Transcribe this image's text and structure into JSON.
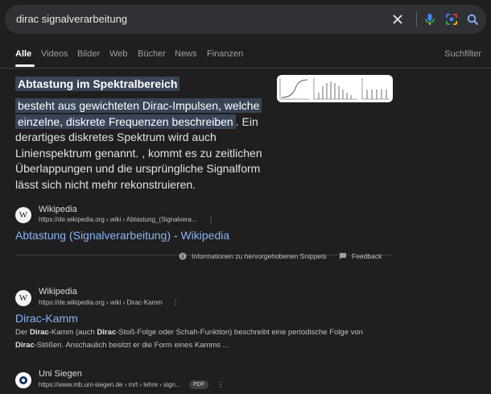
{
  "search": {
    "query": "dirac signalverarbeitung"
  },
  "tabs": [
    {
      "label": "Alle"
    },
    {
      "label": "Videos"
    },
    {
      "label": "Bilder"
    },
    {
      "label": "Web"
    },
    {
      "label": "Bücher"
    },
    {
      "label": "News"
    },
    {
      "label": "Finanzen"
    }
  ],
  "tools_label": "Suchfilter",
  "featured_snippet": {
    "heading": "Abtastung im Spektralbereich",
    "highlight": "besteht aus gewichteten Dirac-Impulsen, welche einzelne, diskrete Frequenzen beschreiben",
    "body": ". Ein derartiges diskretes Spektrum wird auch Linienspektrum genannt. , kommt es zu zeitlichen Überlappungen und die ursprüngliche Signalform lässt sich nicht mehr rekonstruieren.",
    "site": "Wikipedia",
    "url": "https://de.wikipedia.org › wiki › Abtastung_(Signalvera...",
    "title": "Abtastung (Signalverarbeitung) - Wikipedia",
    "about_label": "Informationen zu hervorgehobenen Snippets",
    "feedback_label": "Feedback"
  },
  "results": [
    {
      "site": "Wikipedia",
      "url": "https://de.wikipedia.org › wiki › Dirac-Kamm",
      "title": "Dirac-Kamm",
      "desc_parts": [
        "Der ",
        "Dirac",
        "-Kamm (auch ",
        "Dirac",
        "-Stoß-Folge oder Schah-Funktion) beschreibt eine periodische Folge von ",
        "Dirac",
        "-Stößen. Anschaulich besitzt er die Form eines Kamms ..."
      ]
    },
    {
      "site": "Uni Siegen",
      "url": "https://www.mb.uni-siegen.de › mrt › lehre › sign...",
      "badge": "PDF"
    }
  ],
  "icons": {
    "clear": "close-icon",
    "voice": "microphone-icon",
    "lens": "lens-icon",
    "search": "search-icon",
    "wikipedia": "wikipedia-w-icon",
    "info": "info-icon",
    "feedback": "feedback-icon"
  },
  "colors": {
    "link": "#8ab4f8",
    "highlight": "#394457",
    "background": "#1f1f1f"
  }
}
